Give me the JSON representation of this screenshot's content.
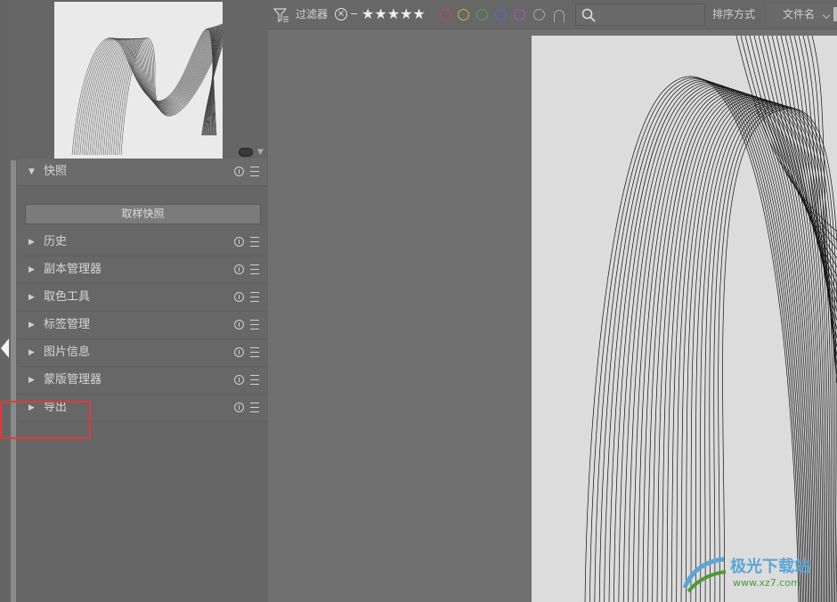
{
  "panels": {
    "snapshot": {
      "title": "快照",
      "button": "取样快照"
    },
    "items": [
      {
        "label": "历史"
      },
      {
        "label": "副本管理器"
      },
      {
        "label": "取色工具"
      },
      {
        "label": "标签管理"
      },
      {
        "label": "图片信息"
      },
      {
        "label": "蒙版管理器"
      },
      {
        "label": "导出"
      }
    ]
  },
  "filterbar": {
    "filter_label": "过滤器",
    "reject_symbol": "−",
    "stars": "★★★★★",
    "clear_symbol": "×",
    "color_labels": [
      {
        "name": "red",
        "color": "#d9453c"
      },
      {
        "name": "yellow",
        "color": "#d4b22b"
      },
      {
        "name": "green",
        "color": "#3fae43"
      },
      {
        "name": "blue",
        "color": "#4d6fd8"
      },
      {
        "name": "purple",
        "color": "#b64cc4"
      }
    ],
    "sort_label": "排序方式",
    "sort_value": "文件名"
  },
  "watermark": {
    "text": "极光下载站",
    "url": "www.xz7.com"
  },
  "colors": {
    "highlight": "#e03a3a",
    "panel_bg": "#666666",
    "viewer_bg": "#707070"
  }
}
